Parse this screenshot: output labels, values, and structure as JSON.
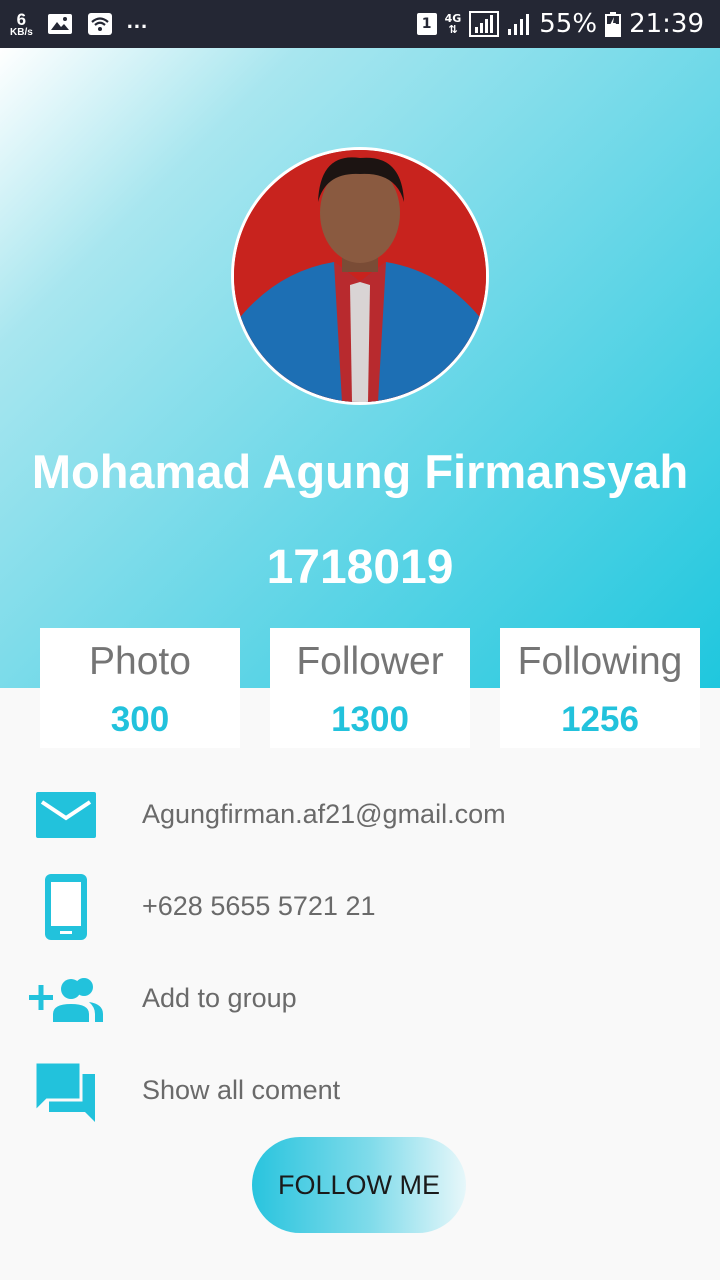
{
  "status_bar": {
    "net_speed_value": "6",
    "net_speed_unit": "KB/s",
    "more_indicator": "...",
    "sim_slot": "1",
    "network_type": "4G",
    "battery_percent": "55%",
    "time": "21:39",
    "icons": [
      "image-icon",
      "wifi-icon",
      "sim-icon",
      "signal-icon",
      "battery-icon"
    ]
  },
  "profile": {
    "name": "Mohamad Agung Firmansyah",
    "id_number": "1718019"
  },
  "stats": [
    {
      "label": "Photo",
      "value": "300"
    },
    {
      "label": "Follower",
      "value": "1300"
    },
    {
      "label": "Following",
      "value": "1256"
    }
  ],
  "contact": {
    "email": "Agungfirman.af21@gmail.com",
    "phone": "+628 5655 5721 21",
    "add_group": "Add to group",
    "comments": "Show all coment"
  },
  "follow_button": {
    "label": "FOLLOW ME"
  },
  "colors": {
    "accent": "#22c2dc",
    "status_bar_bg": "#242734",
    "text_muted": "#6a6a6a"
  }
}
